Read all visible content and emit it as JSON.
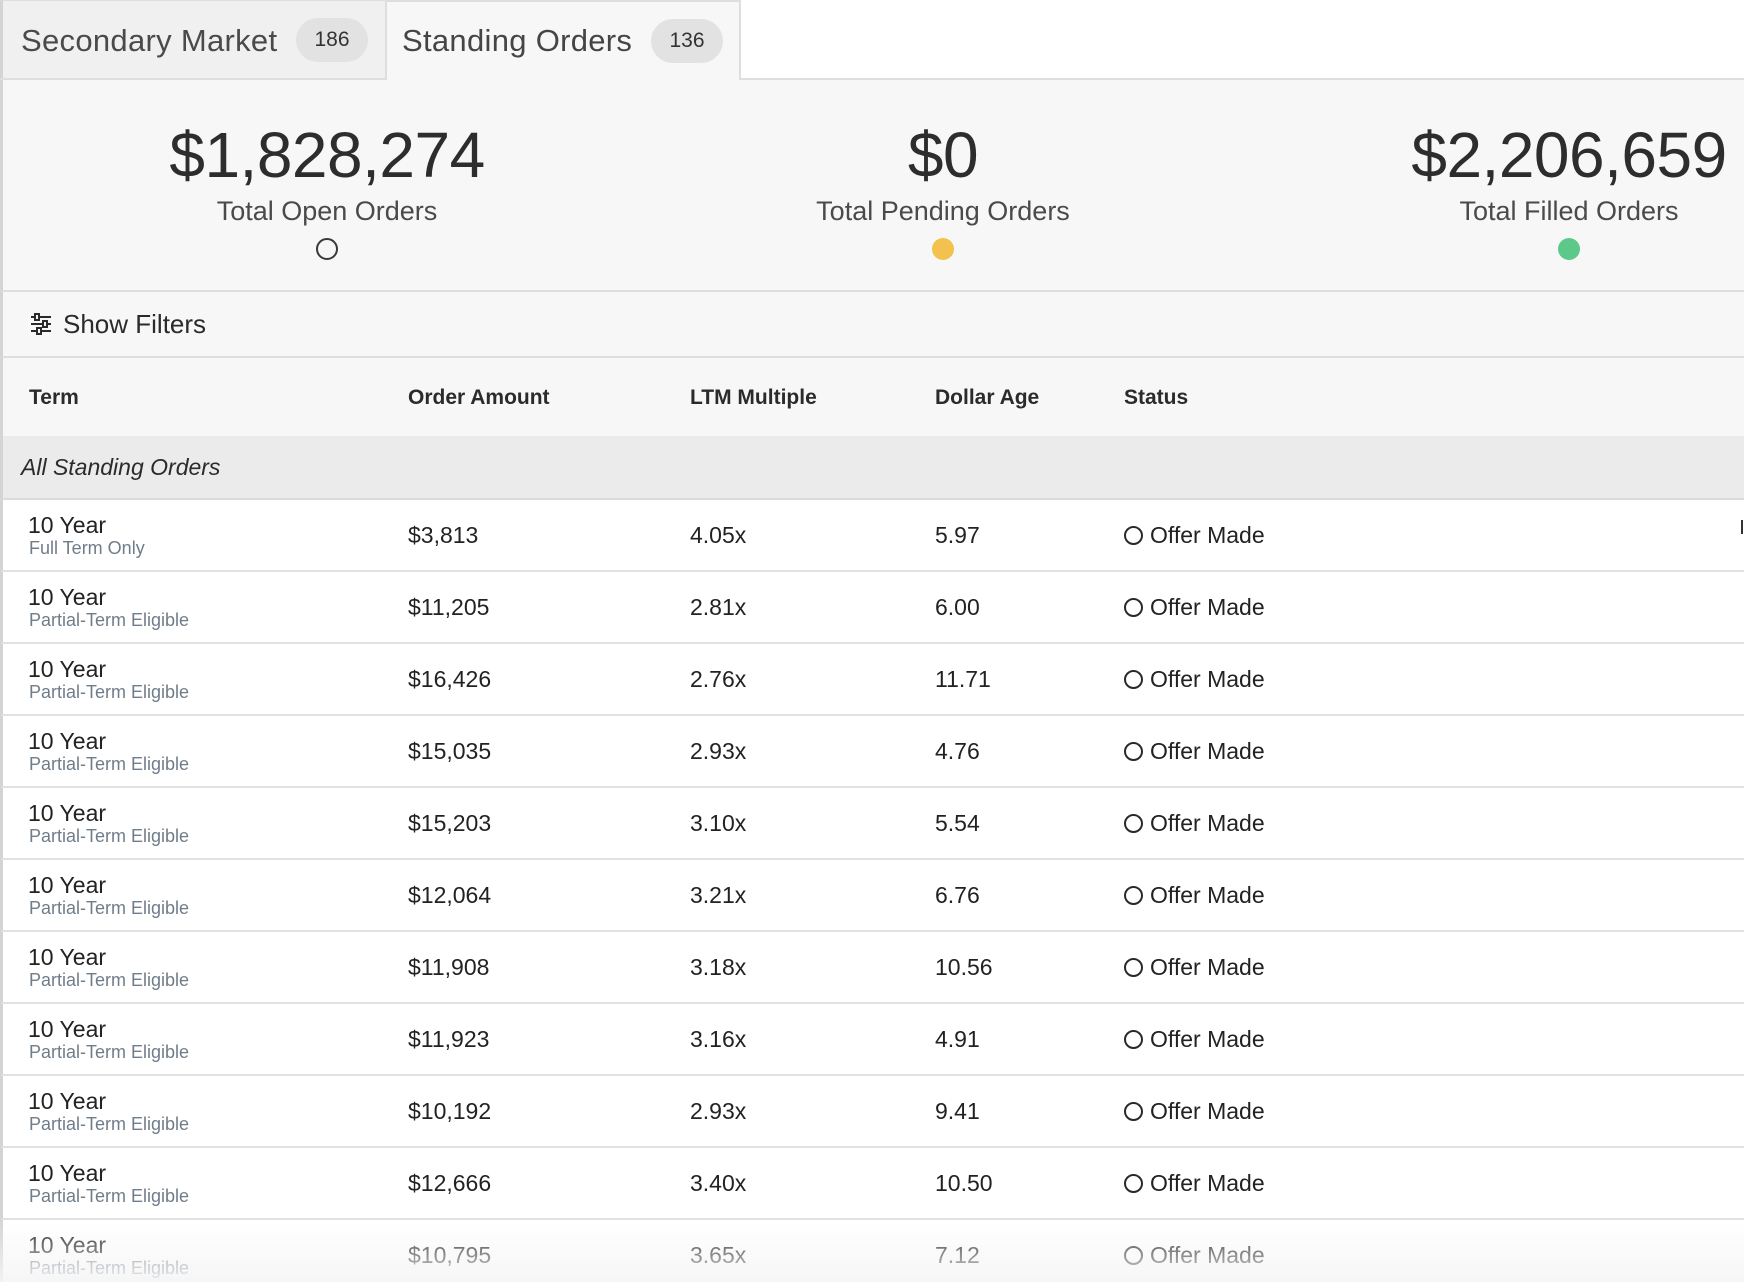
{
  "tabs": [
    {
      "label": "Secondary Market",
      "count": "186",
      "active": false
    },
    {
      "label": "Standing Orders",
      "count": "136",
      "active": true
    }
  ],
  "summary": {
    "open": {
      "value": "$1,828,274",
      "label": "Total Open Orders"
    },
    "pending": {
      "value": "$0",
      "label": "Total Pending Orders",
      "color": "#f2c14e"
    },
    "filled": {
      "value": "$2,206,659",
      "label": "Total Filled Orders",
      "color": "#5cc98b"
    }
  },
  "filters": {
    "label": "Show Filters",
    "icon": "sliders-icon"
  },
  "table": {
    "columns": [
      "Term",
      "Order Amount",
      "LTM Multiple",
      "Dollar Age",
      "Status"
    ],
    "group_label": "All Standing Orders",
    "rows": [
      {
        "term": "10 Year",
        "sub": "Full Term Only",
        "amount": "$3,813",
        "ltm": "4.05x",
        "age": "5.97",
        "status": "Offer Made"
      },
      {
        "term": "10 Year",
        "sub": "Partial-Term Eligible",
        "amount": "$11,205",
        "ltm": "2.81x",
        "age": "6.00",
        "status": "Offer Made"
      },
      {
        "term": "10 Year",
        "sub": "Partial-Term Eligible",
        "amount": "$16,426",
        "ltm": "2.76x",
        "age": "11.71",
        "status": "Offer Made"
      },
      {
        "term": "10 Year",
        "sub": "Partial-Term Eligible",
        "amount": "$15,035",
        "ltm": "2.93x",
        "age": "4.76",
        "status": "Offer Made"
      },
      {
        "term": "10 Year",
        "sub": "Partial-Term Eligible",
        "amount": "$15,203",
        "ltm": "3.10x",
        "age": "5.54",
        "status": "Offer Made"
      },
      {
        "term": "10 Year",
        "sub": "Partial-Term Eligible",
        "amount": "$12,064",
        "ltm": "3.21x",
        "age": "6.76",
        "status": "Offer Made"
      },
      {
        "term": "10 Year",
        "sub": "Partial-Term Eligible",
        "amount": "$11,908",
        "ltm": "3.18x",
        "age": "10.56",
        "status": "Offer Made"
      },
      {
        "term": "10 Year",
        "sub": "Partial-Term Eligible",
        "amount": "$11,923",
        "ltm": "3.16x",
        "age": "4.91",
        "status": "Offer Made"
      },
      {
        "term": "10 Year",
        "sub": "Partial-Term Eligible",
        "amount": "$10,192",
        "ltm": "2.93x",
        "age": "9.41",
        "status": "Offer Made"
      },
      {
        "term": "10 Year",
        "sub": "Partial-Term Eligible",
        "amount": "$12,666",
        "ltm": "3.40x",
        "age": "10.50",
        "status": "Offer Made"
      },
      {
        "term": "10 Year",
        "sub": "Partial-Term Eligible",
        "amount": "$10,795",
        "ltm": "3.65x",
        "age": "7.12",
        "status": "Offer Made"
      }
    ]
  }
}
